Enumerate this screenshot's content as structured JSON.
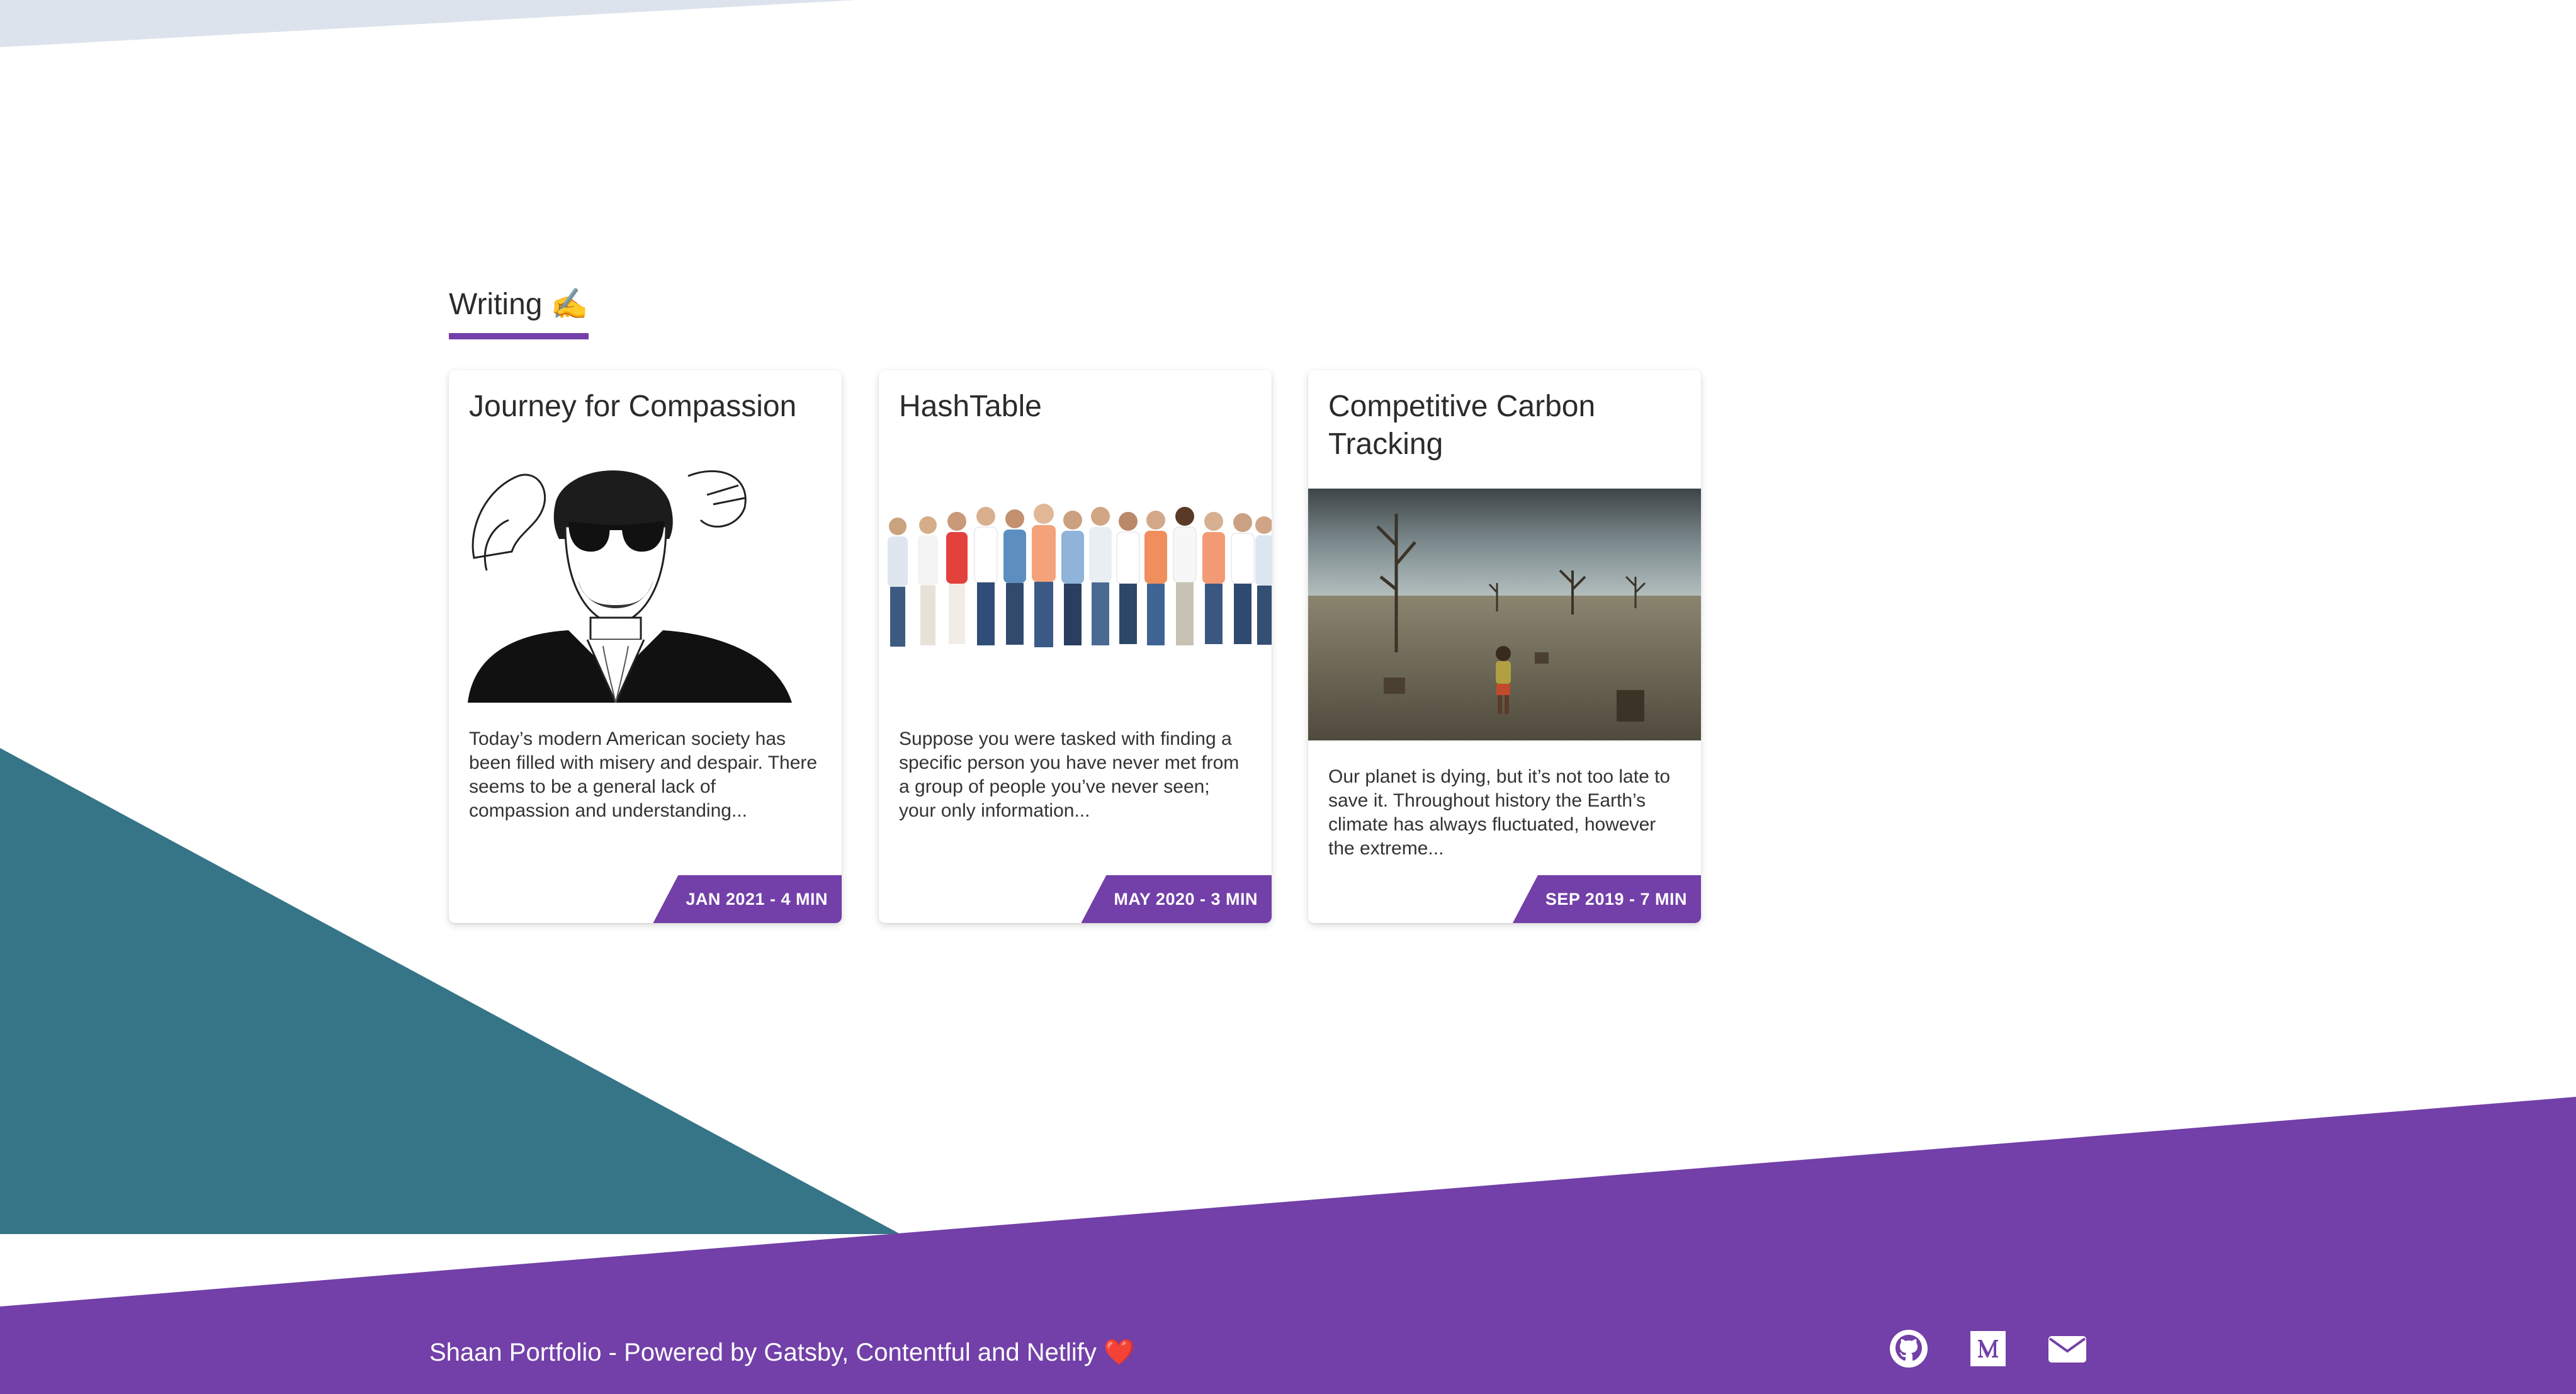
{
  "section": {
    "title": "Writing",
    "emoji": "✍️"
  },
  "posts": [
    {
      "title": "Journey for Compassion",
      "description": "Today’s modern American society has been filled with misery and despair. There seems to be a general lack of compassion and understanding...",
      "tag": "JAN 2021 - 4 MIN",
      "image": "sketch-portrait-image"
    },
    {
      "title": "HashTable",
      "description": "Suppose you were tasked with finding a specific person you have never met from a group of people you’ve never seen; your only information...",
      "tag": "MAY 2020 - 3 MIN",
      "image": "group-of-people-image"
    },
    {
      "title": "Competitive Carbon Tracking",
      "description": "Our planet is dying, but it’s not too late to save it. Throughout history the Earth’s climate has always fluctuated, however the extreme...",
      "tag": "SEP 2019 - 7 MIN",
      "image": "barren-landscape-image"
    }
  ],
  "footer": {
    "prefix": "Shaan Portfolio - Powered by ",
    "gatsby": "Gatsby",
    "sep1": ", ",
    "contentful": "Contentful",
    "and": " and ",
    "netlify": "Netlify",
    "heart": "❤️",
    "icons": [
      "github-icon",
      "medium-icon",
      "email-icon"
    ]
  },
  "colors": {
    "accent": "#7240a8",
    "teal": "#367487",
    "top_strip": "#dde3ec",
    "footer_bg": "#7240a8"
  }
}
